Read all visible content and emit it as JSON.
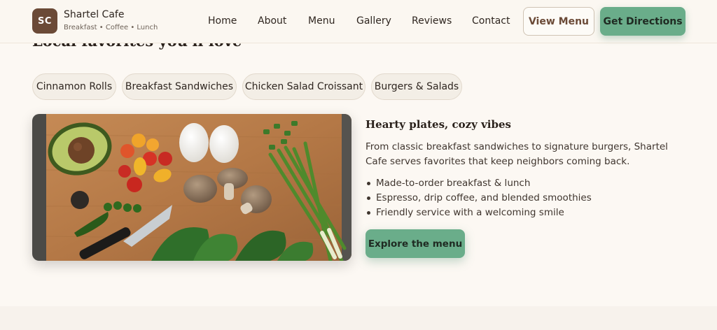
{
  "header": {
    "logo_initials": "SC",
    "brand_name": "Shartel Cafe",
    "brand_tagline": "Breakfast • Coffee • Lunch",
    "nav": [
      "Home",
      "About",
      "Menu",
      "Gallery",
      "Reviews",
      "Contact"
    ],
    "view_menu_label": "View Menu",
    "directions_label": "Get Directions"
  },
  "section": {
    "title": "Local favorites you'll love",
    "chips": [
      "Cinnamon Rolls",
      "Breakfast Sandwiches",
      "Chicken Salad Croissant",
      "Burgers & Salads"
    ]
  },
  "feature": {
    "title": "Hearty plates, cozy vibes",
    "description": "From classic breakfast sandwiches to signature burgers, Shartel Cafe serves favorites that keep neighbors coming back.",
    "bullets": [
      "Made-to-order breakfast & lunch",
      "Espresso, drip coffee, and blended smoothies",
      "Friendly service with a welcoming smile"
    ],
    "cta_label": "Explore the menu"
  },
  "colors": {
    "accent_green": "#6aad8a",
    "brand_brown": "#6b4a37",
    "background": "#fcf8f3"
  }
}
